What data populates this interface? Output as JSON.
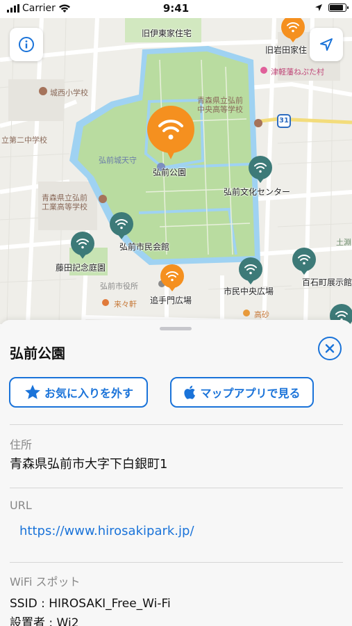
{
  "status_bar": {
    "carrier": "Carrier",
    "time": "9:41"
  },
  "map": {
    "labels": {
      "kyu_ito": "旧伊東家住宅",
      "kyu_iwata": "旧岩田家住",
      "tsugaru_neputa": "津軽藩ねぷた村",
      "jonishi_school": "城西小学校",
      "aomori_chuo_hs": "青森県立弘前\n中央高等学校",
      "route_31": "31",
      "dai2_jhs": "立第二中学校",
      "tenshu": "弘前城天守",
      "park": "弘前公園",
      "bunka_center": "弘前文化センター",
      "kogyo_hs": "青森県立弘前\n工業高等学校",
      "shimin_kaikan": "弘前市民会館",
      "fujita_garden": "藤田記念庭園",
      "city_hall": "弘前市役所",
      "oiteamon": "追手門広場",
      "shimin_chuo": "市民中央広場",
      "hyakkokumachi": "百石町展示館",
      "kurukuken": "来々軒",
      "kosago": "高砂",
      "tsuchibuchi": "土淵"
    }
  },
  "sheet": {
    "title": "弘前公園",
    "favorite_button": "お気に入りを外す",
    "maps_button": "マップアプリで見る",
    "address_label": "住所",
    "address_value": "青森県弘前市大字下白銀町1",
    "url_label": "URL",
    "url_value": "https://www.hirosakipark.jp/",
    "wifi_label": "WiFi スポット",
    "ssid_line": "SSID : HIROSAKI_Free_Wi-Fi",
    "installer_line": "設置者 : Wi2"
  },
  "colors": {
    "accent": "#1a73d9",
    "pin_orange": "#f5901f",
    "pin_teal": "#3d7a78",
    "park_green": "#b9dca0",
    "moat_blue": "#9fd2f2"
  },
  "icons": {
    "info": "info-icon",
    "location": "location-arrow-icon",
    "wifi": "wifi-icon",
    "close": "close-icon",
    "star": "star-icon",
    "apple": "apple-logo-icon"
  }
}
